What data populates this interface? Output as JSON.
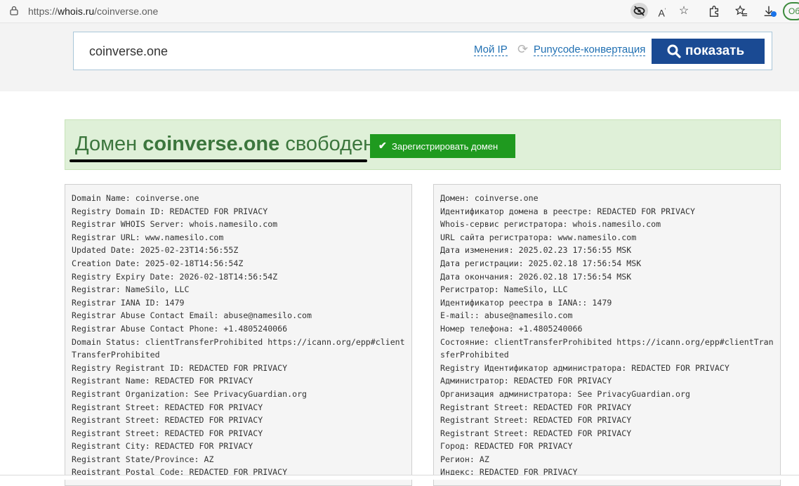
{
  "browser": {
    "url_scheme": "https://",
    "url_host": "whois.ru",
    "url_path": "/coinverse.one",
    "profile_label": "Об"
  },
  "search": {
    "query": "coinverse.one",
    "my_ip_label": "Мой IP",
    "punycode_label": "Punycode-конвертация",
    "show_button_label": "показать"
  },
  "result": {
    "title_prefix": "Домен ",
    "domain": "coinverse.one",
    "title_suffix": " свободен",
    "register_button_label": "Зарегистрировать домен",
    "accent_color": "#3c763d"
  },
  "whois_left": [
    "Domain Name: coinverse.one",
    "Registry Domain ID: REDACTED FOR PRIVACY",
    "Registrar WHOIS Server: whois.namesilo.com",
    "Registrar URL: www.namesilo.com",
    "Updated Date: 2025-02-23T14:56:55Z",
    "Creation Date: 2025-02-18T14:56:54Z",
    "Registry Expiry Date: 2026-02-18T14:56:54Z",
    "Registrar: NameSilo, LLC",
    "Registrar IANA ID: 1479",
    "Registrar Abuse Contact Email: abuse@namesilo.com",
    "Registrar Abuse Contact Phone: +1.4805240066",
    "Domain Status: clientTransferProhibited https://icann.org/epp#clientTransferProhibited",
    "Registry Registrant ID: REDACTED FOR PRIVACY",
    "Registrant Name: REDACTED FOR PRIVACY",
    "Registrant Organization: See PrivacyGuardian.org",
    "Registrant Street: REDACTED FOR PRIVACY",
    "Registrant Street: REDACTED FOR PRIVACY",
    "Registrant Street: REDACTED FOR PRIVACY",
    "Registrant City: REDACTED FOR PRIVACY",
    "Registrant State/Province: AZ",
    "Registrant Postal Code: REDACTED FOR PRIVACY"
  ],
  "whois_right": [
    "Домен: coinverse.one",
    "Идентификатор домена в реестре: REDACTED FOR PRIVACY",
    "Whois-сервис регистратора: whois.namesilo.com",
    "URL сайта регистратора: www.namesilo.com",
    "Дата изменения: 2025.02.23 17:56:55 MSK",
    "Дата регистрации: 2025.02.18 17:56:54 MSK",
    "Дата окончания: 2026.02.18 17:56:54 MSK",
    "Регистратор: NameSilo, LLC",
    "Идентификатор реестра в IANA:: 1479",
    "E-mail:: abuse@namesilo.com",
    "Номер телефона: +1.4805240066",
    "Состояние: clientTransferProhibited https://icann.org/epp#clientTransferProhibited",
    "Registry Идентификатор администратора: REDACTED FOR PRIVACY",
    "Администратор: REDACTED FOR PRIVACY",
    "Организация администратора: See PrivacyGuardian.org",
    "Registrant Street: REDACTED FOR PRIVACY",
    "Registrant Street: REDACTED FOR PRIVACY",
    "Registrant Street: REDACTED FOR PRIVACY",
    "Город: REDACTED FOR PRIVACY",
    "Регион: AZ",
    "Индекс: REDACTED FOR PRIVACY"
  ],
  "icons": {
    "lock": "lock-icon",
    "eye_off": "eye-off-icon",
    "read_aloud": "read-aloud-icon",
    "favorite": "star-icon",
    "extensions": "puzzle-icon",
    "favorites_list": "favorites-icon",
    "downloads": "download-icon",
    "refresh": "refresh-icon",
    "search": "search-icon",
    "check": "check-icon"
  }
}
